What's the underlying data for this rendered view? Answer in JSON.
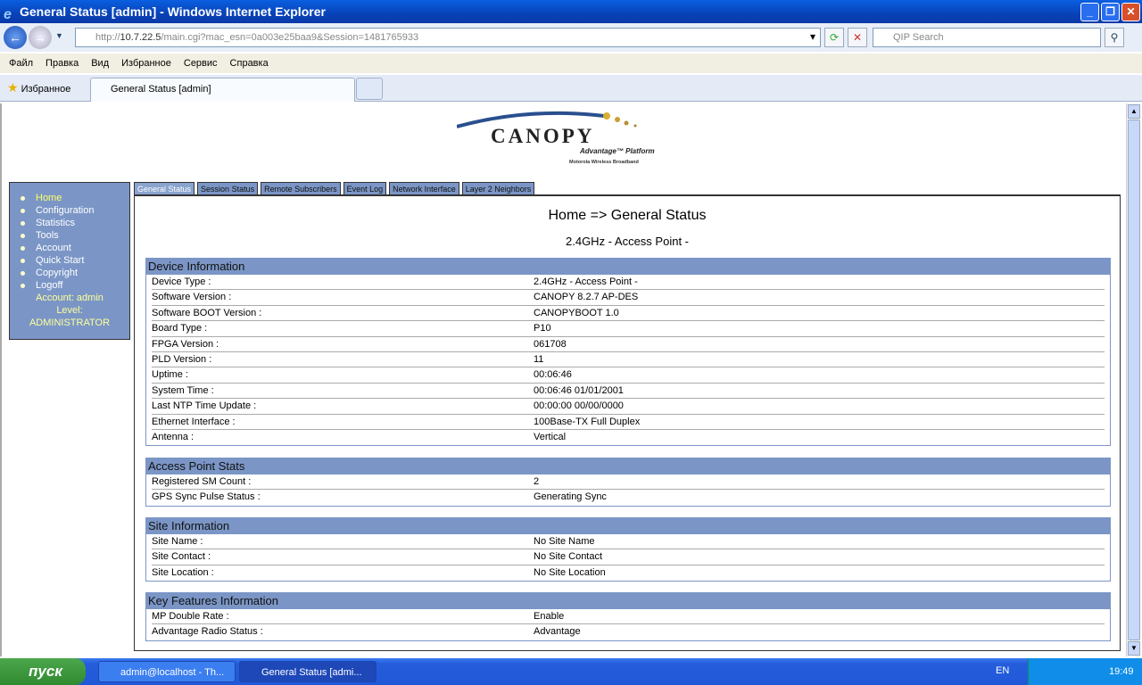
{
  "window": {
    "title": "General Status [admin] - Windows Internet Explorer"
  },
  "address": {
    "scheme": "http://",
    "host": "10.7.22.5",
    "path": "/main.cgi?mac_esn=0a003e25baa9&Session=1481765933",
    "search_placeholder": "QIP Search"
  },
  "menu": [
    "Файл",
    "Правка",
    "Вид",
    "Избранное",
    "Сервис",
    "Справка"
  ],
  "favorites_label": "Избранное",
  "browser_tab": "General Status [admin]",
  "logo": {
    "brand": "CANOPY",
    "line2": "Advantage Platform",
    "line3": "Motorola Wireless Broadband"
  },
  "sidebar": {
    "items": [
      "Home",
      "Configuration",
      "Statistics",
      "Tools",
      "Account",
      "Quick Start",
      "Copyright",
      "Logoff"
    ],
    "account": "Account: admin",
    "level_label": "Level:",
    "level": "ADMINISTRATOR"
  },
  "tabs": [
    "General Status",
    "Session Status",
    "Remote Subscribers",
    "Event Log",
    "Network Interface",
    "Layer 2 Neighbors"
  ],
  "page": {
    "title": "Home => General Status",
    "subtitle": "2.4GHz - Access Point -"
  },
  "sections": [
    {
      "title": "Device Information",
      "rows": [
        [
          "Device Type :",
          "2.4GHz - Access Point -"
        ],
        [
          "Software Version :",
          "CANOPY 8.2.7 AP-DES"
        ],
        [
          "Software BOOT Version :",
          "CANOPYBOOT 1.0"
        ],
        [
          "Board Type :",
          "P10"
        ],
        [
          "FPGA Version :",
          "061708"
        ],
        [
          "PLD Version :",
          "11"
        ],
        [
          "Uptime :",
          "00:06:46"
        ],
        [
          "System Time :",
          "00:06:46 01/01/2001"
        ],
        [
          "Last NTP Time Update :",
          "00:00:00 00/00/0000"
        ],
        [
          "Ethernet Interface :",
          "100Base-TX Full Duplex"
        ],
        [
          "Antenna :",
          "Vertical"
        ]
      ]
    },
    {
      "title": "Access Point Stats",
      "rows": [
        [
          "Registered SM Count :",
          "2"
        ],
        [
          "GPS Sync Pulse Status :",
          "Generating Sync"
        ]
      ]
    },
    {
      "title": "Site Information",
      "rows": [
        [
          "Site Name :",
          "No Site Name"
        ],
        [
          "Site Contact :",
          "No Site Contact"
        ],
        [
          "Site Location :",
          "No Site Location"
        ]
      ]
    },
    {
      "title": "Key Features Information",
      "rows": [
        [
          "MP Double Rate :",
          "Enable"
        ],
        [
          "Advantage Radio Status :",
          "Advantage"
        ]
      ]
    }
  ],
  "taskbar": {
    "start": "пуск",
    "items": [
      "admin@localhost - Th...",
      "General Status [admi..."
    ],
    "lang": "EN",
    "clock": "19:49"
  }
}
